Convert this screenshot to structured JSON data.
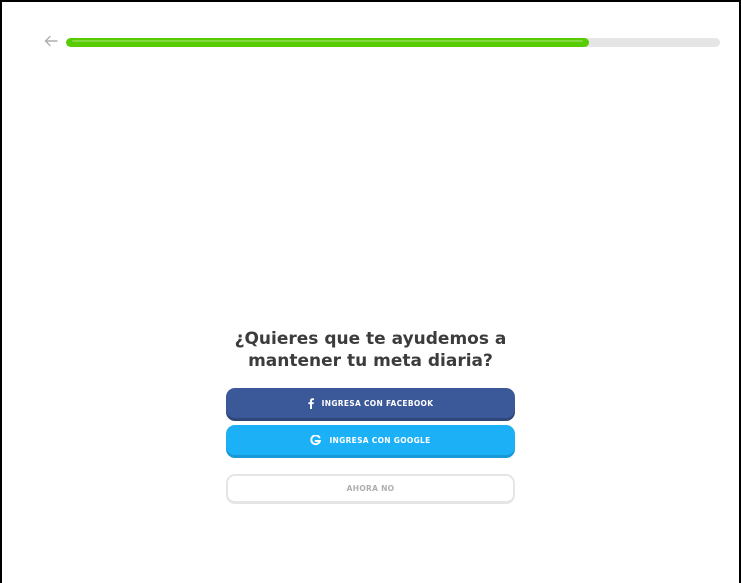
{
  "header": {
    "back_icon": "arrow-left-icon",
    "progress": 0.8
  },
  "prompt": {
    "title": "¿Quieres que te ayudemos a mantener tu meta diaria?"
  },
  "buttons": {
    "facebook_label": "INGRESA CON FACEBOOK",
    "facebook_icon": "facebook-icon",
    "google_label": "INGRESA CON GOOGLE",
    "google_icon": "google-icon",
    "skip_label": "AHORA NO"
  },
  "colors": {
    "progress_fill": "#58cc02",
    "progress_track": "#e5e5e5",
    "facebook": "#3b5998",
    "google": "#1cb0f6",
    "text": "#3c3c3c",
    "skip_text": "#afafaf"
  }
}
